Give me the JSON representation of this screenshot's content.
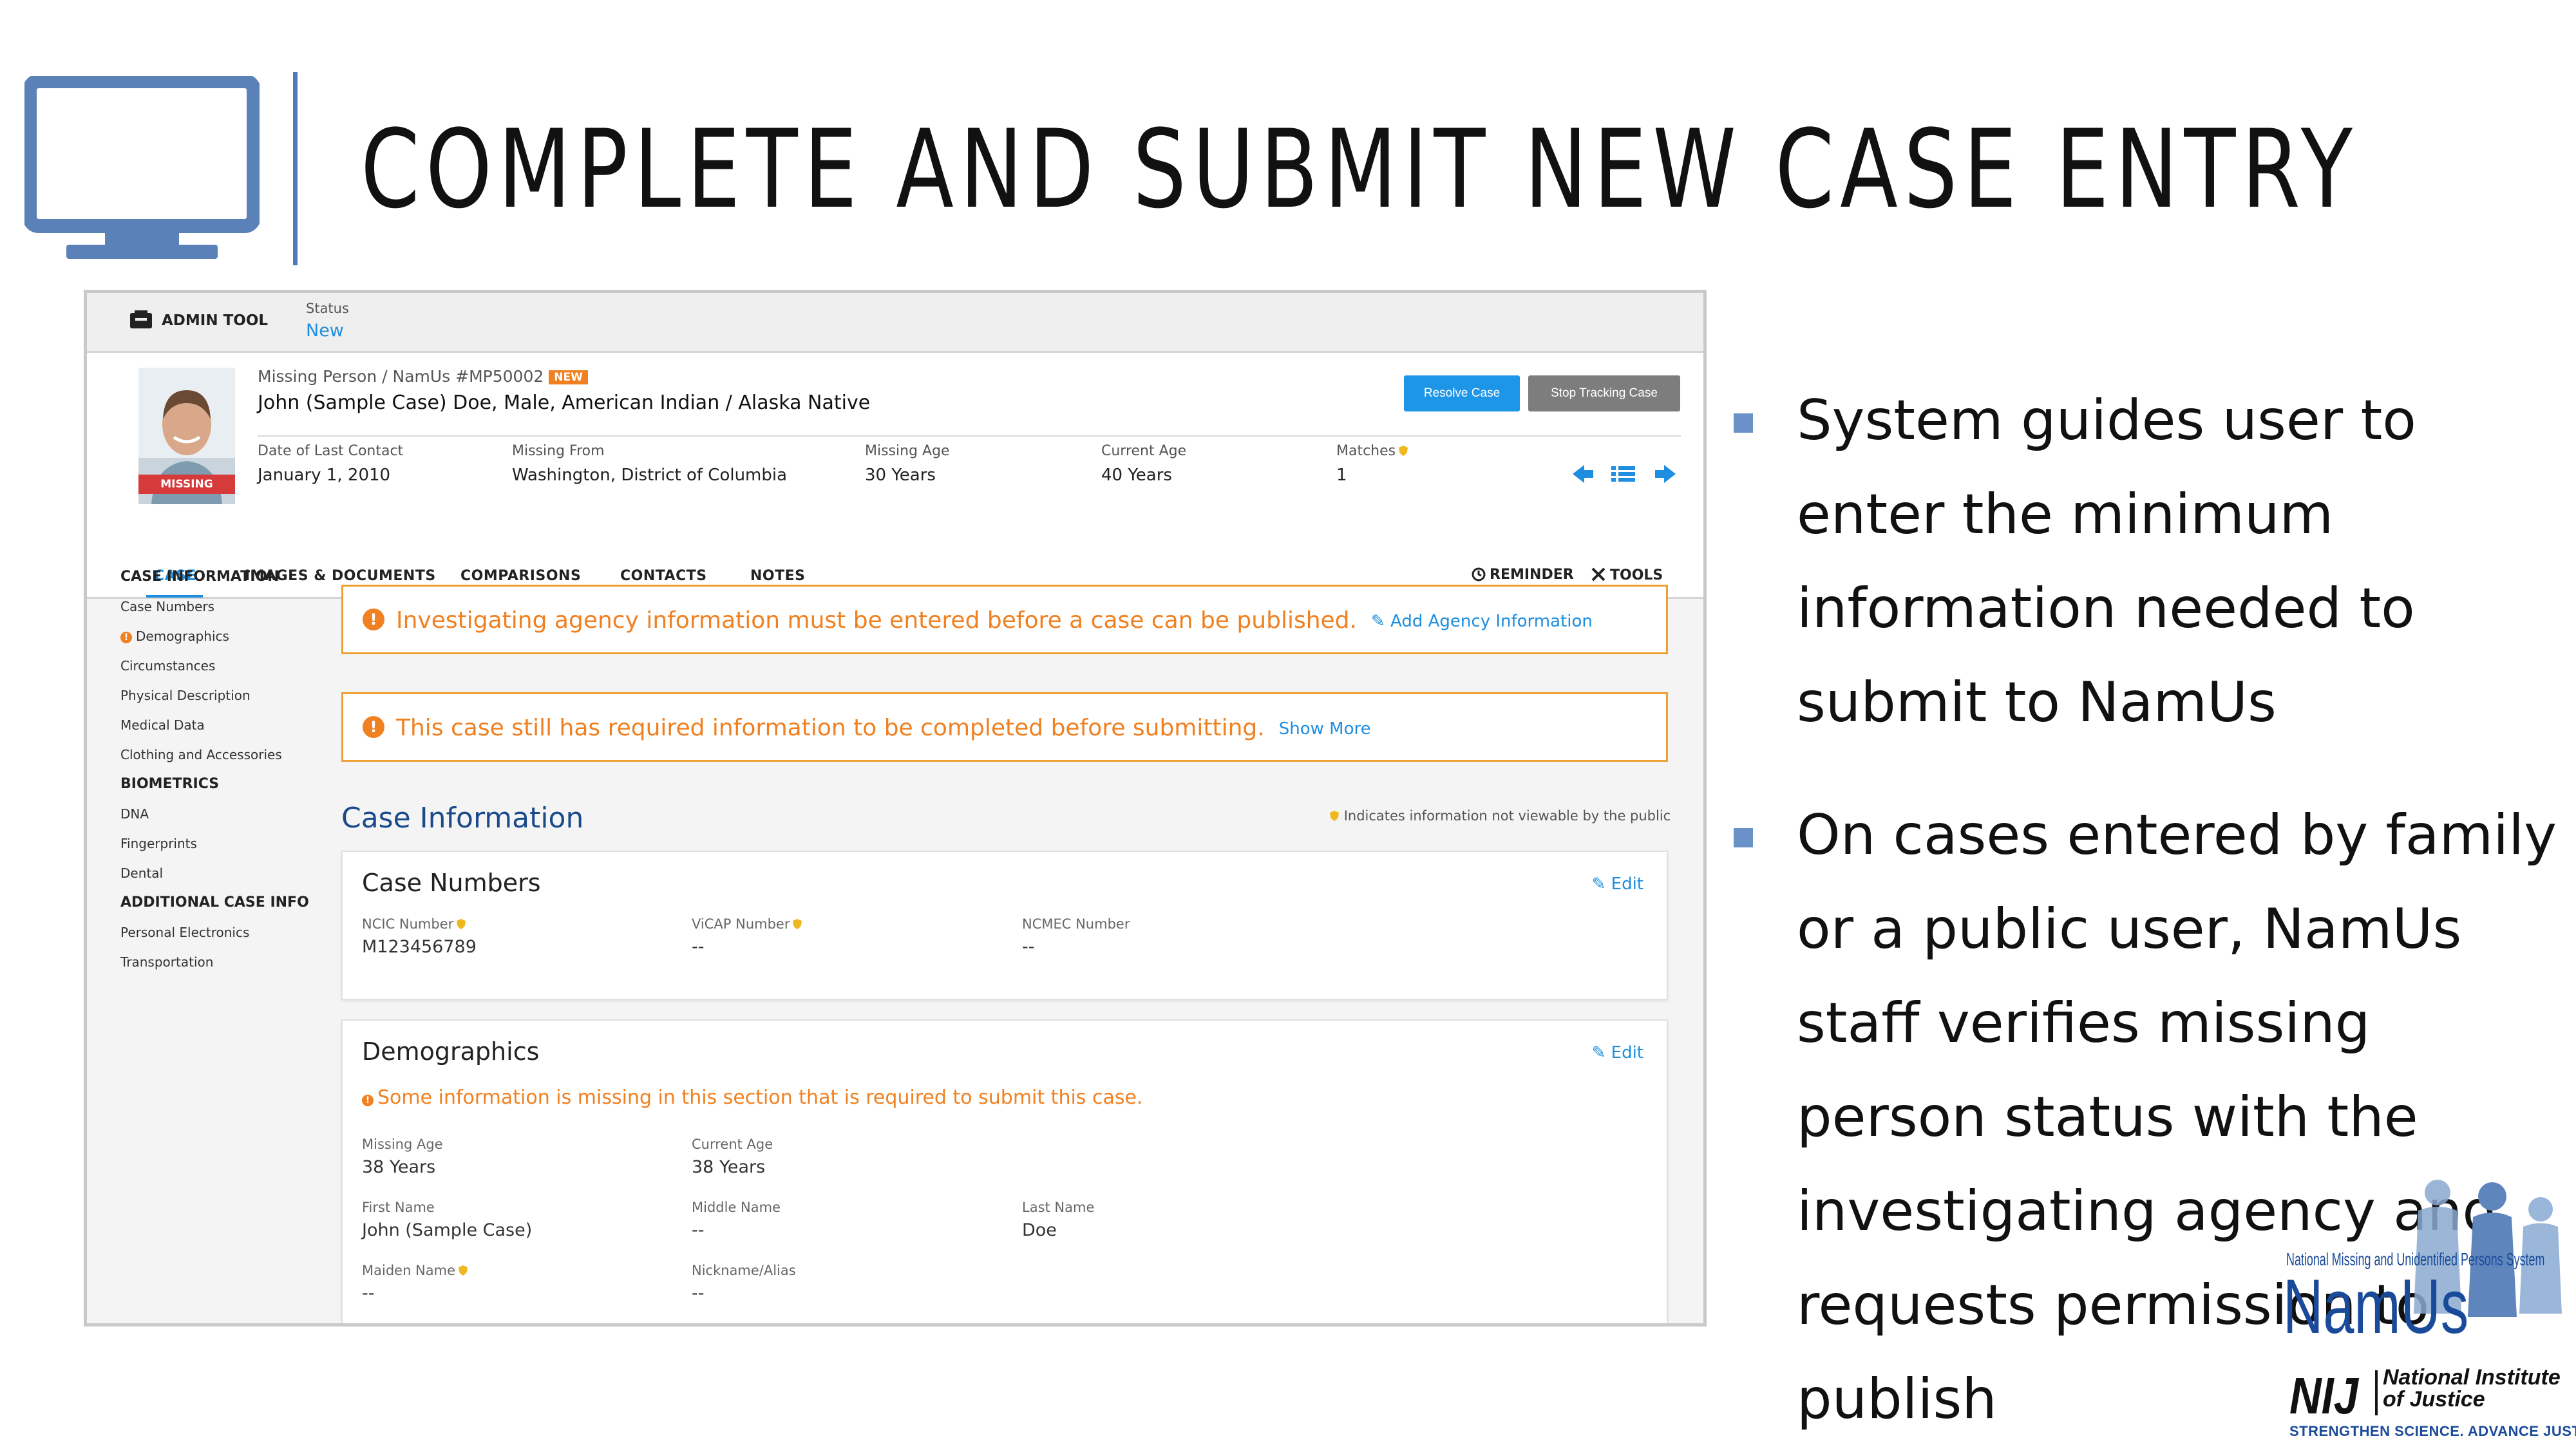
{
  "slide": {
    "title": "COMPLETE AND SUBMIT NEW CASE ENTRY",
    "bullets": [
      "System guides user to enter the minimum information needed to submit to NamUs",
      "On cases entered by family or a public user, NamUs staff verifies missing person status with the investigating agency and requests permission to publish"
    ]
  },
  "app": {
    "admin_tool_label": "ADMIN TOOL",
    "status_label": "Status",
    "status_value": "New",
    "case_id_line": "Missing Person / NamUs #MP50002",
    "new_badge": "NEW",
    "case_name": "John (Sample Case) Doe, Male, American Indian / Alaska Native",
    "photo_badge": "MISSING",
    "resolve_button": "Resolve Case",
    "stop_button": "Stop Tracking Case",
    "meta": [
      {
        "label": "Date of Last Contact",
        "value": "January 1, 2010"
      },
      {
        "label": "Missing From",
        "value": "Washington, District of Columbia"
      },
      {
        "label": "Missing Age",
        "value": "30 Years"
      },
      {
        "label": "Current Age",
        "value": "40 Years"
      },
      {
        "label": "Matches",
        "value": "1"
      }
    ],
    "tabs": [
      "CASE",
      "IMAGES & DOCUMENTS",
      "COMPARISONS",
      "CONTACTS",
      "NOTES"
    ],
    "reminder_label": "REMINDER",
    "tools_label": "TOOLS",
    "sidebar": {
      "case_information": "CASE INFORMATION",
      "case_items": [
        "Case Numbers",
        "Demographics",
        "Circumstances",
        "Physical Description",
        "Medical Data",
        "Clothing and Accessories"
      ],
      "biometrics": "BIOMETRICS",
      "biometric_items": [
        "DNA",
        "Fingerprints",
        "Dental"
      ],
      "additional": "ADDITIONAL CASE INFO",
      "additional_items": [
        "Personal Electronics",
        "Transportation"
      ]
    },
    "alerts": {
      "agency_text": "Investigating agency information must be entered before a case can be published.",
      "agency_link": "Add Agency Information",
      "required_text": "This case still has required information to be completed before submitting.",
      "required_link": "Show More"
    },
    "section_title": "Case Information",
    "privacy_note": "Indicates information not viewable by the public",
    "edit_label": "Edit",
    "case_numbers": {
      "title": "Case Numbers",
      "fields": [
        {
          "label": "NCIC Number",
          "value": "M123456789"
        },
        {
          "label": "ViCAP Number",
          "value": "--"
        },
        {
          "label": "NCMEC Number",
          "value": "--"
        }
      ]
    },
    "demographics": {
      "title": "Demographics",
      "warning": "Some information is missing in this section that is required to submit this case.",
      "fields": [
        {
          "label": "Missing Age",
          "value": "38 Years"
        },
        {
          "label": "Current Age",
          "value": "38 Years"
        },
        {
          "label": "First Name",
          "value": "John (Sample Case)"
        },
        {
          "label": "Middle Name",
          "value": "--"
        },
        {
          "label": "Last Name",
          "value": "Doe"
        },
        {
          "label": "Maiden Name",
          "value": "--"
        },
        {
          "label": "Nickname/Alias",
          "value": "--"
        }
      ]
    }
  },
  "logos": {
    "namus_word": "NamUs",
    "namus_tagline": "National Missing and Unidentified Persons System",
    "nij_mark": "NIJ",
    "nij_name_line1": "National Institute",
    "nij_name_line2": "of Justice",
    "nij_tagline": "STRENGTHEN SCIENCE. ADVANCE JUSTICE."
  },
  "colors": {
    "accent_blue": "#1d8ee0",
    "warning_orange": "#f08020",
    "slide_blue": "#4f7bb8",
    "namus_blue": "#1a4a9a"
  }
}
